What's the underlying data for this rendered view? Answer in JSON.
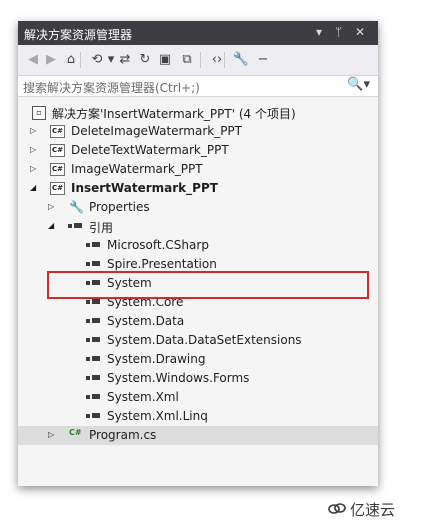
{
  "panel": {
    "title": "解决方案资源管理器",
    "title_icons": [
      "chevron-down-icon",
      "pin-icon",
      "close-icon"
    ],
    "title_glyphs": {
      "dropdown": "▾",
      "pin": "ᛘ",
      "close": "✕"
    }
  },
  "toolbar": {
    "buttons": [
      {
        "name": "back-icon",
        "glyph": "◀",
        "dim": true
      },
      {
        "name": "forward-icon",
        "glyph": "▶",
        "dim": true
      },
      {
        "name": "home-icon",
        "glyph": "⌂",
        "dim": false
      },
      {
        "name": "history-icon",
        "glyph": "⟲",
        "dim": false
      },
      {
        "name": "dropdown-icon",
        "glyph": "▾",
        "dim": false
      },
      {
        "name": "sync-icon",
        "glyph": "⇄",
        "dim": false
      },
      {
        "name": "refresh-icon",
        "glyph": "↻",
        "dim": false
      },
      {
        "name": "collapse-all-icon",
        "glyph": "▣",
        "dim": false
      },
      {
        "name": "show-all-files-icon",
        "glyph": "⧉",
        "dim": false
      },
      {
        "name": "view-code-icon",
        "glyph": "‹›",
        "dim": false
      },
      {
        "name": "properties-icon",
        "glyph": "🔧",
        "dim": false
      },
      {
        "name": "minus-icon",
        "glyph": "−",
        "dim": false
      }
    ]
  },
  "search": {
    "placeholder": "搜索解决方案资源管理器(Ctrl+;)",
    "icon": "search-icon",
    "glyph": "🔍▾"
  },
  "tree": {
    "solution_label": "解决方案'InsertWatermark_PPT' (4 个项目)",
    "projects": [
      {
        "label": "DeleteImageWatermark_PPT",
        "expanded": false
      },
      {
        "label": "DeleteTextWatermark_PPT",
        "expanded": false
      },
      {
        "label": "ImageWatermark_PPT",
        "expanded": false
      },
      {
        "label": "InsertWatermark_PPT",
        "expanded": true
      }
    ],
    "properties_label": "Properties",
    "references_label": "引用",
    "references": [
      "Microsoft.CSharp",
      "Spire.Presentation",
      "System",
      "System.Core",
      "System.Data",
      "System.Data.DataSetExtensions",
      "System.Drawing",
      "System.Windows.Forms",
      "System.Xml",
      "System.Xml.Linq"
    ],
    "program_file": "Program.cs",
    "cs_badge": "C#"
  },
  "annotation": {
    "highlighted_item": "Spire.Presentation",
    "color": "#d12c2c"
  },
  "watermark": {
    "text": "亿速云"
  },
  "colors": {
    "titlebar": "#3e3e42",
    "panel_bg": "#f5f5f5",
    "selection": "#dcdcdc"
  }
}
